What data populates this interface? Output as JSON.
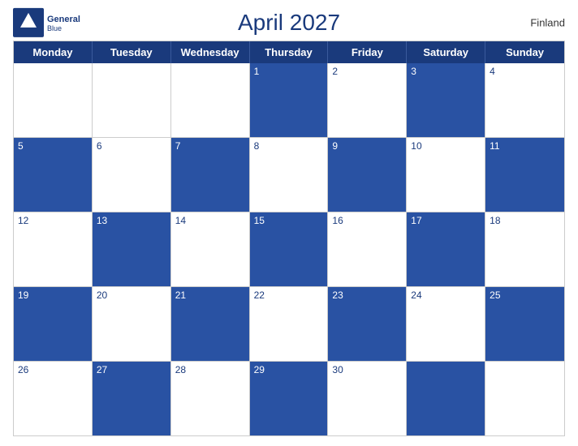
{
  "header": {
    "title": "April 2027",
    "country": "Finland",
    "logo": {
      "brand": "General",
      "blue": "Blue"
    }
  },
  "days_of_week": [
    "Monday",
    "Tuesday",
    "Wednesday",
    "Thursday",
    "Friday",
    "Saturday",
    "Sunday"
  ],
  "weeks": [
    [
      {
        "num": "",
        "empty": true,
        "dark": false
      },
      {
        "num": "",
        "empty": true,
        "dark": false
      },
      {
        "num": "",
        "empty": true,
        "dark": false
      },
      {
        "num": "1",
        "empty": false,
        "dark": true
      },
      {
        "num": "2",
        "empty": false,
        "dark": false
      },
      {
        "num": "3",
        "empty": false,
        "dark": true
      },
      {
        "num": "4",
        "empty": false,
        "dark": false
      }
    ],
    [
      {
        "num": "5",
        "empty": false,
        "dark": true
      },
      {
        "num": "6",
        "empty": false,
        "dark": false
      },
      {
        "num": "7",
        "empty": false,
        "dark": true
      },
      {
        "num": "8",
        "empty": false,
        "dark": false
      },
      {
        "num": "9",
        "empty": false,
        "dark": true
      },
      {
        "num": "10",
        "empty": false,
        "dark": false
      },
      {
        "num": "11",
        "empty": false,
        "dark": true
      }
    ],
    [
      {
        "num": "12",
        "empty": false,
        "dark": false
      },
      {
        "num": "13",
        "empty": false,
        "dark": true
      },
      {
        "num": "14",
        "empty": false,
        "dark": false
      },
      {
        "num": "15",
        "empty": false,
        "dark": true
      },
      {
        "num": "16",
        "empty": false,
        "dark": false
      },
      {
        "num": "17",
        "empty": false,
        "dark": true
      },
      {
        "num": "18",
        "empty": false,
        "dark": false
      }
    ],
    [
      {
        "num": "19",
        "empty": false,
        "dark": true
      },
      {
        "num": "20",
        "empty": false,
        "dark": false
      },
      {
        "num": "21",
        "empty": false,
        "dark": true
      },
      {
        "num": "22",
        "empty": false,
        "dark": false
      },
      {
        "num": "23",
        "empty": false,
        "dark": true
      },
      {
        "num": "24",
        "empty": false,
        "dark": false
      },
      {
        "num": "25",
        "empty": false,
        "dark": true
      }
    ],
    [
      {
        "num": "26",
        "empty": false,
        "dark": false
      },
      {
        "num": "27",
        "empty": false,
        "dark": true
      },
      {
        "num": "28",
        "empty": false,
        "dark": false
      },
      {
        "num": "29",
        "empty": false,
        "dark": true
      },
      {
        "num": "30",
        "empty": false,
        "dark": false
      },
      {
        "num": "",
        "empty": true,
        "dark": true
      },
      {
        "num": "",
        "empty": true,
        "dark": false
      }
    ]
  ]
}
